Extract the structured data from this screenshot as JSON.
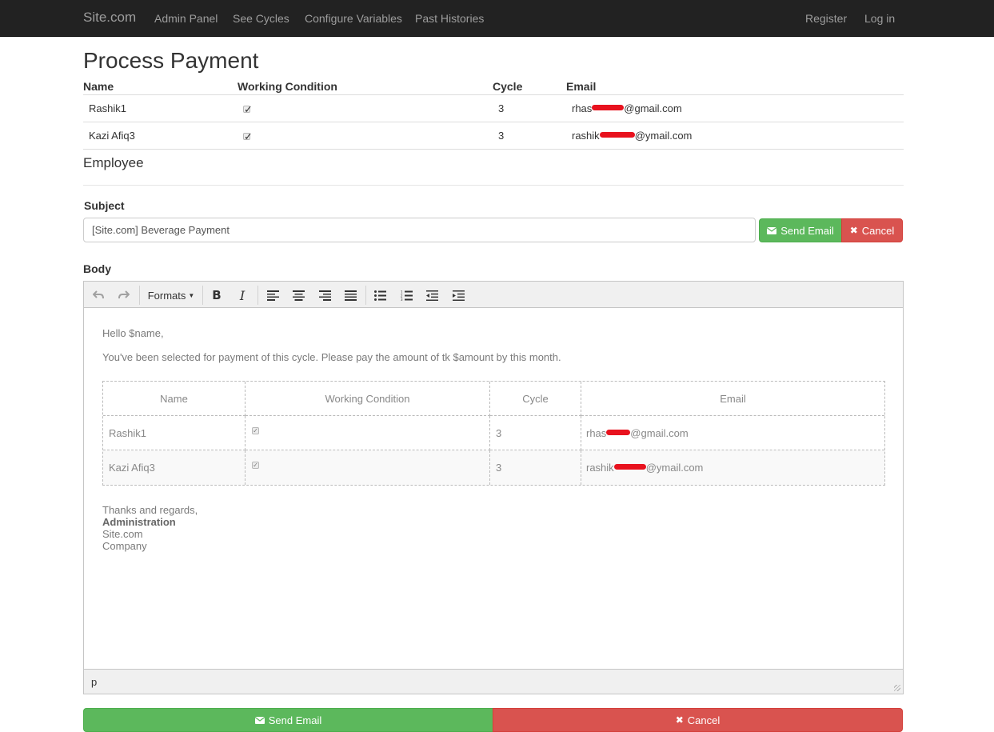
{
  "nav": {
    "brand": "Site.com",
    "links": [
      "Admin Panel",
      "See Cycles",
      "Configure Variables",
      "Past Histories"
    ],
    "right": [
      "Register",
      "Log in"
    ]
  },
  "page_title": "Process Payment",
  "table": {
    "headers": [
      "Name",
      "Working Condition",
      "Cycle",
      "Email"
    ],
    "rows": [
      {
        "name": "Rashik1",
        "working": true,
        "cycle": "3",
        "email_start": "rhas",
        "email_end": "@gmail.com"
      },
      {
        "name": "Kazi Afiq3",
        "working": true,
        "cycle": "3",
        "email_start": "rashik",
        "email_end": "@ymail.com"
      }
    ]
  },
  "section_title": "Employee",
  "subject": {
    "label": "Subject",
    "value": "[Site.com] Beverage Payment"
  },
  "buttons": {
    "send": "Send Email",
    "cancel": "Cancel"
  },
  "body": {
    "label": "Body",
    "toolbar": {
      "formats": "Formats"
    },
    "greeting": "Hello $name,",
    "message": "You've been selected for payment of this cycle. Please pay the amount of tk $amount by this month.",
    "signoff": [
      "Thanks and regards,",
      "Administration",
      "Site.com",
      "Company"
    ],
    "status_path": "p"
  },
  "colors": {
    "navbar": "#222222",
    "success": "#5cb85c",
    "danger": "#d9534f",
    "redaction": "#e8121e"
  }
}
